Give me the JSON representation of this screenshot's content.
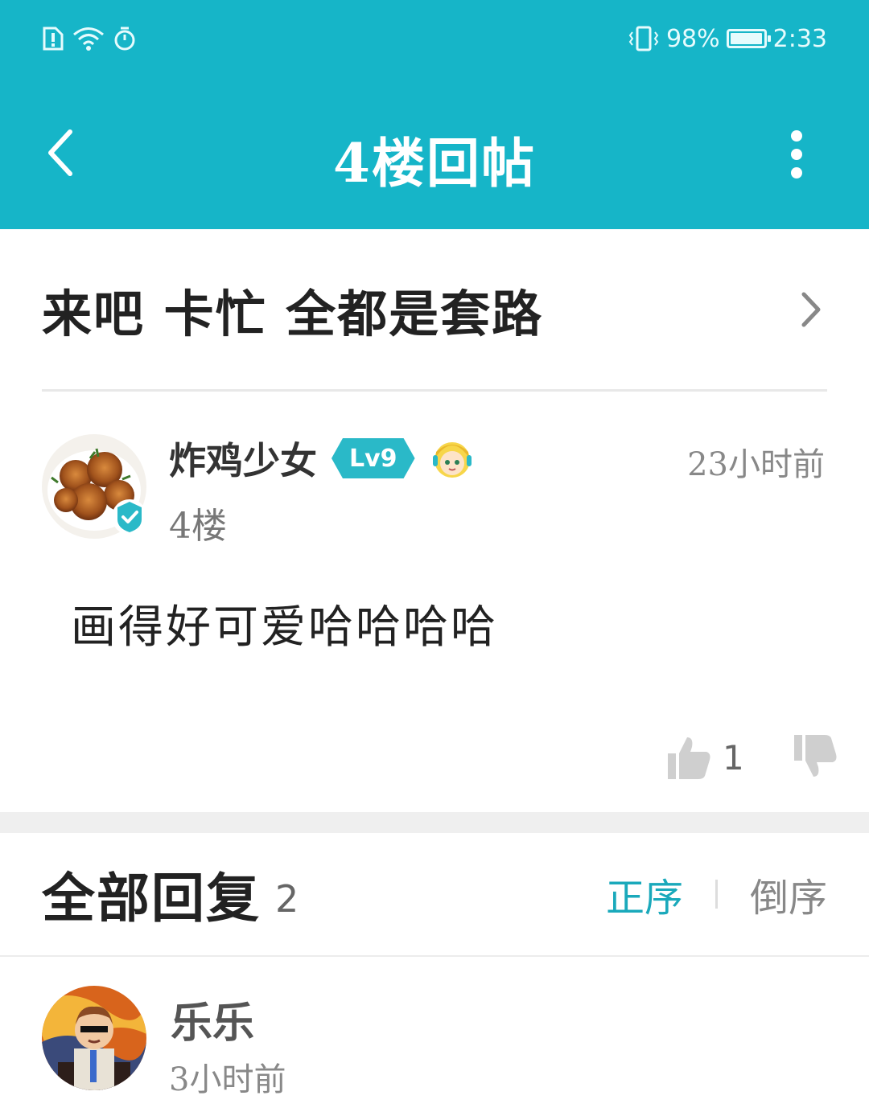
{
  "status_bar": {
    "battery_percent": "98%",
    "battery_level": 0.98,
    "time": "2:33",
    "icons": [
      "sim-alert-icon",
      "wifi-icon",
      "timer-icon",
      "vibrate-icon",
      "battery-icon"
    ]
  },
  "header": {
    "title": "4楼回帖",
    "background_color": "#16b5c8"
  },
  "topic": {
    "title": "来吧 卡忙 全都是套路"
  },
  "post": {
    "author": "炸鸡少女",
    "level": "Lv9",
    "time": "23小时前",
    "floor": "4楼",
    "body": "画得好可爱哈哈哈哈",
    "like_count": "1"
  },
  "replies": {
    "title": "全部回复",
    "count": "2",
    "sort_asc": "正序",
    "sort_desc": "倒序",
    "accent_color": "#1aa9bb",
    "items": [
      {
        "author": "乐乐",
        "time": "3小时前"
      }
    ]
  }
}
